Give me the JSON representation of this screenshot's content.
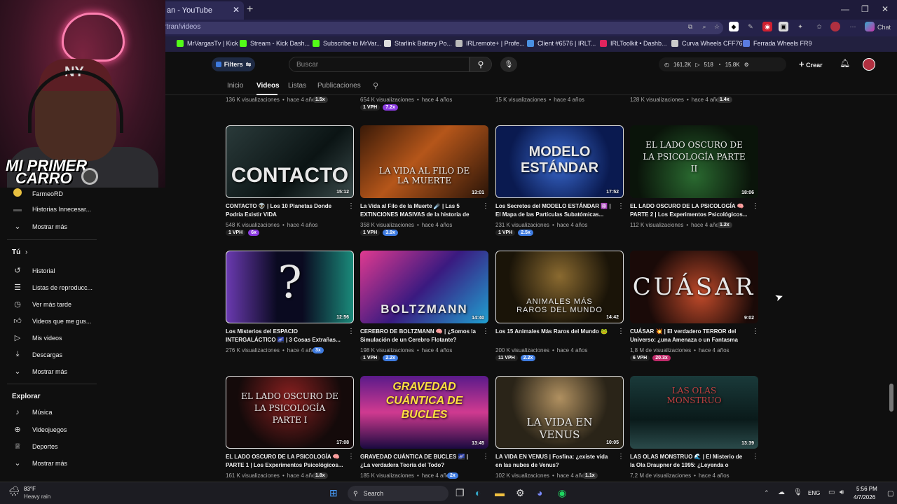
{
  "browser": {
    "tab_title": "an - YouTube",
    "url_fragment": "rtran/videos",
    "bookmarks": [
      {
        "label": "MrVargasTv | Kick",
        "color": "#53fc18"
      },
      {
        "label": "Stream - Kick Dash...",
        "color": "#53fc18"
      },
      {
        "label": "Subscribe to MrVar...",
        "color": "#53fc18"
      },
      {
        "label": "Starlink Battery Po...",
        "color": "#dddddd"
      },
      {
        "label": "IRLremote+ | Profe...",
        "color": "#bbbbbb"
      },
      {
        "label": "Client #6576 | IRLT...",
        "color": "#4a90e2"
      },
      {
        "label": "IRLToolkit • Dashb...",
        "color": "#e0245e"
      },
      {
        "label": "Curva Wheels CFF76",
        "color": "#cccccc"
      },
      {
        "label": "Ferrada Wheels FR9",
        "color": "#5a7be0"
      }
    ],
    "chat_label": "Chat"
  },
  "webcam": {
    "overlay_line1": "MI PRIMER",
    "overlay_line2": "CARRO"
  },
  "header": {
    "filters_label": "Filters",
    "search_placeholder": "Buscar",
    "stats": {
      "views": "161.2K",
      "videos": "518",
      "subs": "15.8K"
    },
    "create_label": "Crear"
  },
  "nav": {
    "tabs": [
      "Inicio",
      "Videos",
      "Listas",
      "Publicaciones"
    ],
    "active": "Videos"
  },
  "sidebar": {
    "subs": [
      {
        "label": "FarmeoRD"
      },
      {
        "label": "Historias Innecesar..."
      }
    ],
    "show_more_1": "Mostrar más",
    "you_heading": "Tú",
    "you_items": [
      {
        "label": "Historial",
        "icon": "history-icon"
      },
      {
        "label": "Listas de reproducc...",
        "icon": "playlist-icon"
      },
      {
        "label": "Ver más tarde",
        "icon": "clock-icon"
      },
      {
        "label": "Videos que me gus...",
        "icon": "thumbs-up-icon"
      },
      {
        "label": "Mis videos",
        "icon": "my-videos-icon"
      },
      {
        "label": "Descargas",
        "icon": "download-icon"
      }
    ],
    "show_more_2": "Mostrar más",
    "explore_heading": "Explorar",
    "explore_items": [
      {
        "label": "Música",
        "icon": "music-icon"
      },
      {
        "label": "Videojuegos",
        "icon": "gamepad-icon"
      },
      {
        "label": "Deportes",
        "icon": "trophy-icon"
      }
    ],
    "show_more_3": "Mostrar más"
  },
  "top_partial_row": [
    {
      "views": "136 K visualizaciones",
      "age": "hace 4 años",
      "pills": [
        {
          "t": "1.5x",
          "c": "grey"
        }
      ]
    },
    {
      "views": "654 K visualizaciones",
      "age": "hace 4 años",
      "pills": [
        {
          "t": "1 VPH",
          "c": "vph"
        },
        {
          "t": "7.2x",
          "c": "purple"
        }
      ]
    },
    {
      "views": "15 K visualizaciones",
      "age": "hace 4 años",
      "pills": []
    },
    {
      "views": "128 K visualizaciones",
      "age": "hace 4 años",
      "pills": [
        {
          "t": "1.4x",
          "c": "grey"
        }
      ]
    }
  ],
  "videos": [
    {
      "thumb_text": "CONTACTO",
      "duration": "15:12",
      "title": "CONTACTO 👽 | Los 10 Planetas Donde Podría Existir VIDA",
      "views": "548 K visualizaciones",
      "age": "hace 4 años",
      "pills": [
        {
          "t": "1 VPH",
          "c": "vph"
        },
        {
          "t": "6x",
          "c": "purple"
        }
      ],
      "bg": "linear-gradient(135deg,#2a3a3a,#0b1414 60%,#3a4a4a)"
    },
    {
      "thumb_text": "LA VIDA AL FILO DE LA MUERTE",
      "duration": "13:01",
      "title": "La Vida al Filo de la Muerte ☄️ | Las 5 EXTINCIONES MASIVAS de la historia de la...",
      "views": "358 K visualizaciones",
      "age": "hace 4 años",
      "pills": [
        {
          "t": "1 VPH",
          "c": "vph"
        },
        {
          "t": "3.9x",
          "c": "blue"
        }
      ],
      "bg": "linear-gradient(135deg,#3a1a08,#b5561a 45%,#2a1408)"
    },
    {
      "thumb_text": "MODELO ESTÁNDAR",
      "duration": "17:52",
      "title": "Los Secretos del MODELO ESTÁNDAR ⚛️ | El Mapa de las Partículas Subatómicas...",
      "views": "231 K visualizaciones",
      "age": "hace 4 años",
      "pills": [
        {
          "t": "1 VPH",
          "c": "vph"
        },
        {
          "t": "2.5x",
          "c": "blue"
        }
      ],
      "bg": "radial-gradient(circle at 50% 50%,#3a6ad0,#0a1a50 70%)"
    },
    {
      "thumb_text": "EL LADO OSCURO DE LA PSICOLOGÍA PARTE II",
      "duration": "18:06",
      "title": "EL LADO OSCURO DE LA PSICOLOGÍA 🧠 PARTE 2 | Los Experimentos Psicológicos...",
      "views": "112 K visualizaciones",
      "age": "hace 4 años",
      "pills": [
        {
          "t": "1.2x",
          "c": "grey"
        }
      ],
      "bg": "radial-gradient(circle at 50% 70%,#2a6a30,#0a140a 70%)"
    },
    {
      "thumb_text": "?",
      "duration": "12:56",
      "title": "Los Misterios del ESPACIO INTERGALÁCTICO 🌌 | 3 Cosas Extrañas...",
      "views": "276 K visualizaciones",
      "age": "hace 4 años",
      "pills": [
        {
          "t": "3x",
          "c": "blue"
        }
      ],
      "bg": "linear-gradient(90deg,#6a3ab0,#0a0a20 40%,#0a0a20 60%,#1a8a7a)"
    },
    {
      "thumb_text": "BOLTZMANN",
      "duration": "14:40",
      "title": "CEREBRO DE BOLTZMANN 🧠 | ¿Somos la Simulación de un Cerebro Flotante?",
      "views": "198 K visualizaciones",
      "age": "hace 4 años",
      "pills": [
        {
          "t": "1 VPH",
          "c": "vph"
        },
        {
          "t": "2.2x",
          "c": "blue"
        }
      ],
      "bg": "linear-gradient(135deg,#e03a90,#3a1a80 50%,#20a0d0)"
    },
    {
      "thumb_text": "ANIMALES MÁS RAROS DEL MUNDO",
      "duration": "14:42",
      "title": "Los 15 Animales Más Raros del Mundo 🐸",
      "views": "200 K visualizaciones",
      "age": "hace 4 años",
      "pills": [
        {
          "t": "11 VPH",
          "c": "vph"
        },
        {
          "t": "2.2x",
          "c": "blue"
        }
      ],
      "bg": "radial-gradient(circle at 50% 35%,#8a6a30,#1a1408 65%)"
    },
    {
      "thumb_text": "CUÁSAR",
      "duration": "9:02",
      "title": "CUÁSAR 💥 | El verdadero TERROR del Universo: ¿una Amenaza o un Fantasma de...",
      "views": "1,8 M de visualizaciones",
      "age": "hace 4 años",
      "pills": [
        {
          "t": "6 VPH",
          "c": "vph"
        },
        {
          "t": "20.3x",
          "c": "pink"
        }
      ],
      "bg": "radial-gradient(circle at 55% 60%,#c04a2a,#1a0a08 65%)"
    },
    {
      "thumb_text": "EL LADO OSCURO DE LA PSICOLOGÍA PARTE I",
      "duration": "17:08",
      "title": "EL LADO OSCURO DE LA PSICOLOGÍA 🧠 PARTE 1 | Los Experimentos Psicológicos...",
      "views": "161 K visualizaciones",
      "age": "hace 4 años",
      "pills": [
        {
          "t": "1.8x",
          "c": "grey"
        }
      ],
      "bg": "radial-gradient(circle at 50% 30%,#8a2020,#140a0a 65%)"
    },
    {
      "thumb_text": "GRAVEDAD CUÁNTICA DE BUCLES",
      "duration": "13:45",
      "title": "GRAVEDAD CUÁNTICA DE BUCLES 🌌 | ¿La verdadera Teoría del Todo?",
      "views": "185 K visualizaciones",
      "age": "hace 4 años",
      "pills": [
        {
          "t": "2x",
          "c": "blue"
        }
      ],
      "bg": "linear-gradient(180deg,#5a1a8a,#d03a90 50%,#1a0a40)"
    },
    {
      "thumb_text": "LA VIDA EN VENUS",
      "duration": "10:05",
      "title": "LA VIDA EN VENUS | Fosfina: ¿existe vida en las nubes de Venus?",
      "views": "102 K visualizaciones",
      "age": "hace 4 años",
      "pills": [
        {
          "t": "1.1x",
          "c": "grey"
        }
      ],
      "bg": "radial-gradient(circle at 50% 30%,#b09060,#2a2418 60%)"
    },
    {
      "thumb_text": "LAS OLAS MONSTRUO",
      "duration": "13:39",
      "title": "LAS OLAS MONSTRUO 🌊 | El Misterio de la Ola Draupner de 1995: ¿Leyenda o Terrible...",
      "views": "7,2 M de visualizaciones",
      "age": "hace 4 años",
      "pills": [],
      "bg": "linear-gradient(180deg,#1a3a3a,#0a1a1a 60%,#2a4a4a)"
    }
  ],
  "taskbar": {
    "weather_temp": "83°F",
    "weather_cond": "Heavy rain",
    "search_label": "Search",
    "lang": "ENG",
    "time": "5:56 PM",
    "date": "4/7/2026"
  }
}
